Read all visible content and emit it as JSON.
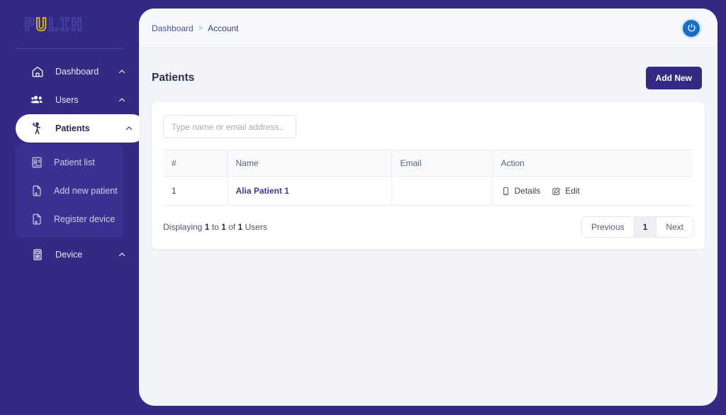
{
  "brand": {
    "logo_text": "PULIH",
    "logo_highlight_char": "U",
    "logo_outline_color": "#4a44a8",
    "logo_highlight_color": "#f2c819"
  },
  "theme": {
    "sidebar_bg": "#332b83",
    "panel_bg": "#f2f4f9",
    "accent": "#332b83",
    "link": "#3f3a95",
    "power_icon_bg": "#1a6fc4"
  },
  "sidebar": {
    "items": [
      {
        "label": "Dashboard",
        "icon": "home-icon",
        "chevron": "chevron-up-icon",
        "active": false
      },
      {
        "label": "Users",
        "icon": "users-icon",
        "chevron": "chevron-up-icon",
        "active": false
      },
      {
        "label": "Patients",
        "icon": "patient-icon",
        "chevron": "chevron-up-icon",
        "active": true
      },
      {
        "label": "Device",
        "icon": "device-icon",
        "chevron": "chevron-up-icon",
        "active": false
      }
    ],
    "submenu": [
      {
        "label": "Patient list",
        "icon": "patient-list-icon"
      },
      {
        "label": "Add new patient",
        "icon": "file-plus-icon"
      },
      {
        "label": "Register device",
        "icon": "file-plus-icon"
      }
    ]
  },
  "topbar": {
    "breadcrumb": {
      "root": "Dashboard",
      "separator": ">",
      "current": "Account"
    },
    "power_button": "power-icon"
  },
  "page": {
    "title": "Patients",
    "add_new_label": "Add New"
  },
  "search": {
    "value": "",
    "placeholder": "Type name or email address.."
  },
  "table": {
    "columns": [
      "#",
      "Name",
      "Email",
      "Action"
    ],
    "rows": [
      {
        "num": "1",
        "name": "Alia Patient 1",
        "email": "",
        "actions": [
          {
            "label": "Details",
            "icon": "mobile-device-icon"
          },
          {
            "label": "Edit",
            "icon": "edit-square-icon"
          }
        ]
      }
    ]
  },
  "footer": {
    "displaying_prefix": "Displaying ",
    "from": "1",
    "mid_to": " to ",
    "to": "1",
    "mid_of": " of ",
    "total": "1",
    "suffix": " Users",
    "pagination": {
      "previous": "Previous",
      "current_page": "1",
      "next": "Next"
    }
  }
}
